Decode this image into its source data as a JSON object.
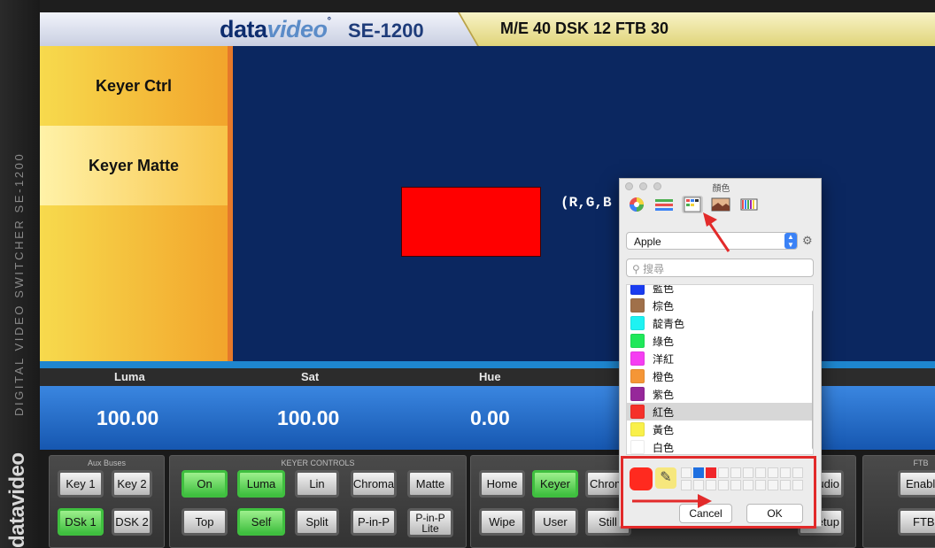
{
  "left_strip": {
    "product_text": "DIGITAL VIDEO SWITCHER  SE-1200",
    "logo_text": "datavideo"
  },
  "header": {
    "logo_data": "data",
    "logo_video": "video",
    "model": "SE-1200",
    "info": "M/E 40  DSK 12  FTB 30"
  },
  "sidenav": {
    "items": [
      {
        "label": "Keyer Ctrl"
      },
      {
        "label": "Keyer Matte"
      }
    ]
  },
  "main": {
    "swatch_color": "#ff0000",
    "rgb_text": "(R,G,B"
  },
  "params": {
    "labels": [
      "Luma",
      "Sat",
      "Hue"
    ],
    "values": [
      "100.00",
      "100.00",
      "0.00"
    ]
  },
  "groups": {
    "aux": {
      "title": "Aux Buses",
      "buttons": [
        "Key 1",
        "Key 2",
        "DSk 1",
        "DSK 2"
      ]
    },
    "keyer": {
      "title": "KEYER CONTROLS",
      "buttons": [
        "On",
        "Luma",
        "Lin",
        "Chroma",
        "Matte",
        "Top",
        "Self",
        "Split",
        "P-in-P",
        "P-in-P Lite"
      ]
    },
    "menu": {
      "buttons": [
        "Home",
        "Keyer",
        "Chroma",
        "Wipe",
        "User",
        "Still",
        "Audio",
        "Setup"
      ]
    },
    "ftb": {
      "title": "FTB",
      "buttons": [
        "Enable",
        "FTB"
      ]
    }
  },
  "picker": {
    "title": "顏色",
    "palette": "Apple",
    "search_placeholder": "搜尋",
    "colors": [
      {
        "name": "藍色",
        "hex": "#1a3cf0"
      },
      {
        "name": "棕色",
        "hex": "#a0704a"
      },
      {
        "name": "靛青色",
        "hex": "#1ef2f2"
      },
      {
        "name": "綠色",
        "hex": "#1fe85a"
      },
      {
        "name": "洋紅",
        "hex": "#f53ef2"
      },
      {
        "name": "橙色",
        "hex": "#f59636"
      },
      {
        "name": "紫色",
        "hex": "#96279a"
      },
      {
        "name": "紅色",
        "hex": "#f5302a"
      },
      {
        "name": "黃色",
        "hex": "#f9f04a"
      },
      {
        "name": "白色",
        "hex": "#ffffff"
      }
    ],
    "selected": "紅色",
    "cancel": "Cancel",
    "ok": "OK"
  },
  "accent": {
    "annotation": "#e22a2a",
    "header_blue": "#0e2d6e",
    "panel_blue": "#0b2760"
  }
}
